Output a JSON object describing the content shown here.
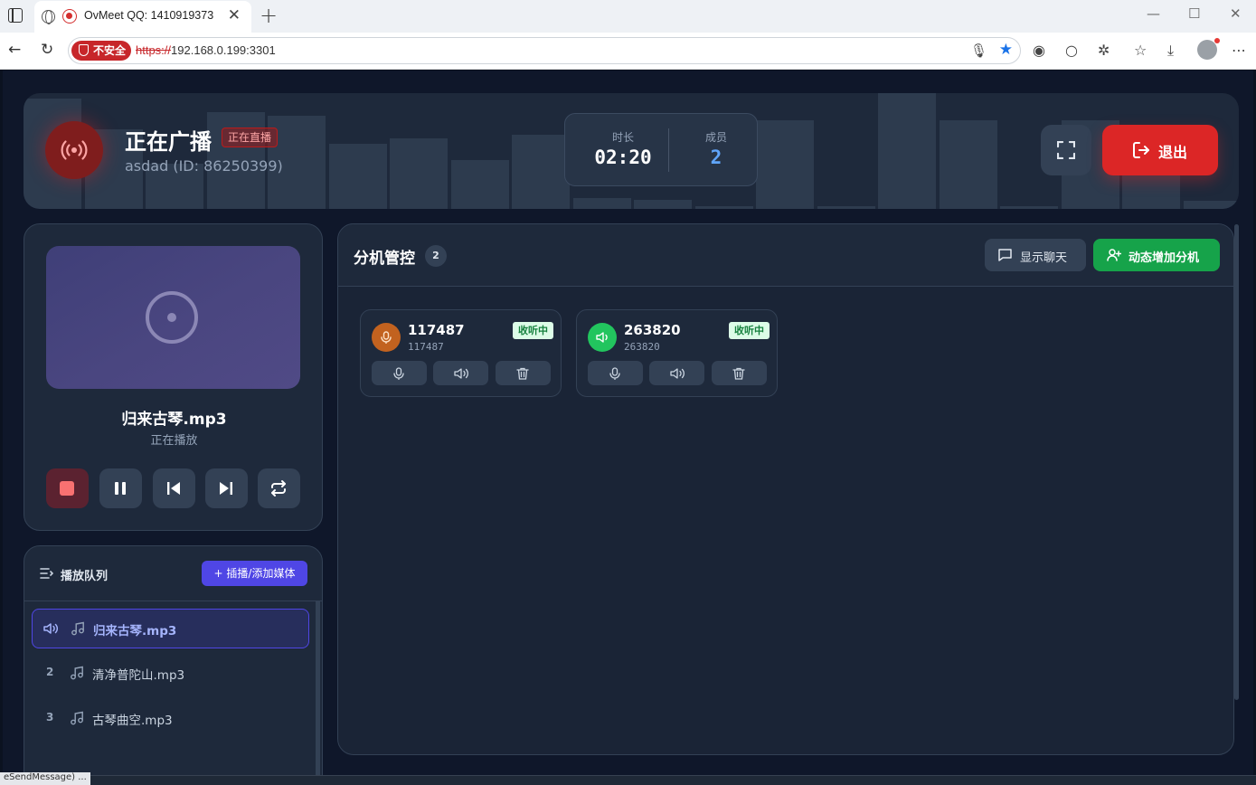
{
  "browser": {
    "tab_title": "OvMeet QQ: 1410919373",
    "insecure_label": "不安全",
    "url_scheme": "https://",
    "url_rest": "192.168.0.199:3301",
    "status_text": "eSendMessage) ..."
  },
  "header": {
    "title": "正在广播",
    "live_badge": "正在直播",
    "subtitle": "asdad (ID: 86250399)",
    "duration_label": "时长",
    "duration_value": "02:20",
    "members_label": "成员",
    "members_value": "2",
    "exit_label": "退出"
  },
  "player": {
    "track_title": "归来古琴.mp3",
    "status": "正在播放"
  },
  "queue": {
    "title": "播放队列",
    "add_label": "+ 插播/添加媒体",
    "items": [
      {
        "num": "",
        "name": "归来古琴.mp3",
        "active": true
      },
      {
        "num": "2",
        "name": "清净普陀山.mp3",
        "active": false
      },
      {
        "num": "3",
        "name": "古琴曲空.mp3",
        "active": false
      }
    ]
  },
  "extensions": {
    "title": "分机管控",
    "count": "2",
    "chat_label": "显示聊天",
    "add_label": "动态增加分机",
    "cards": [
      {
        "name": "117487",
        "sub": "117487",
        "status": "收听中",
        "avatar_color": "#c2621f",
        "avatar_icon": "mic-icon"
      },
      {
        "name": "263820",
        "sub": "263820",
        "status": "收听中",
        "avatar_color": "#22c55e",
        "avatar_icon": "speaker-icon"
      }
    ]
  },
  "colors": {
    "accent_red": "#dc2626",
    "accent_green": "#16a34a",
    "accent_indigo": "#4f46e5",
    "members_blue": "#60a5fa"
  }
}
